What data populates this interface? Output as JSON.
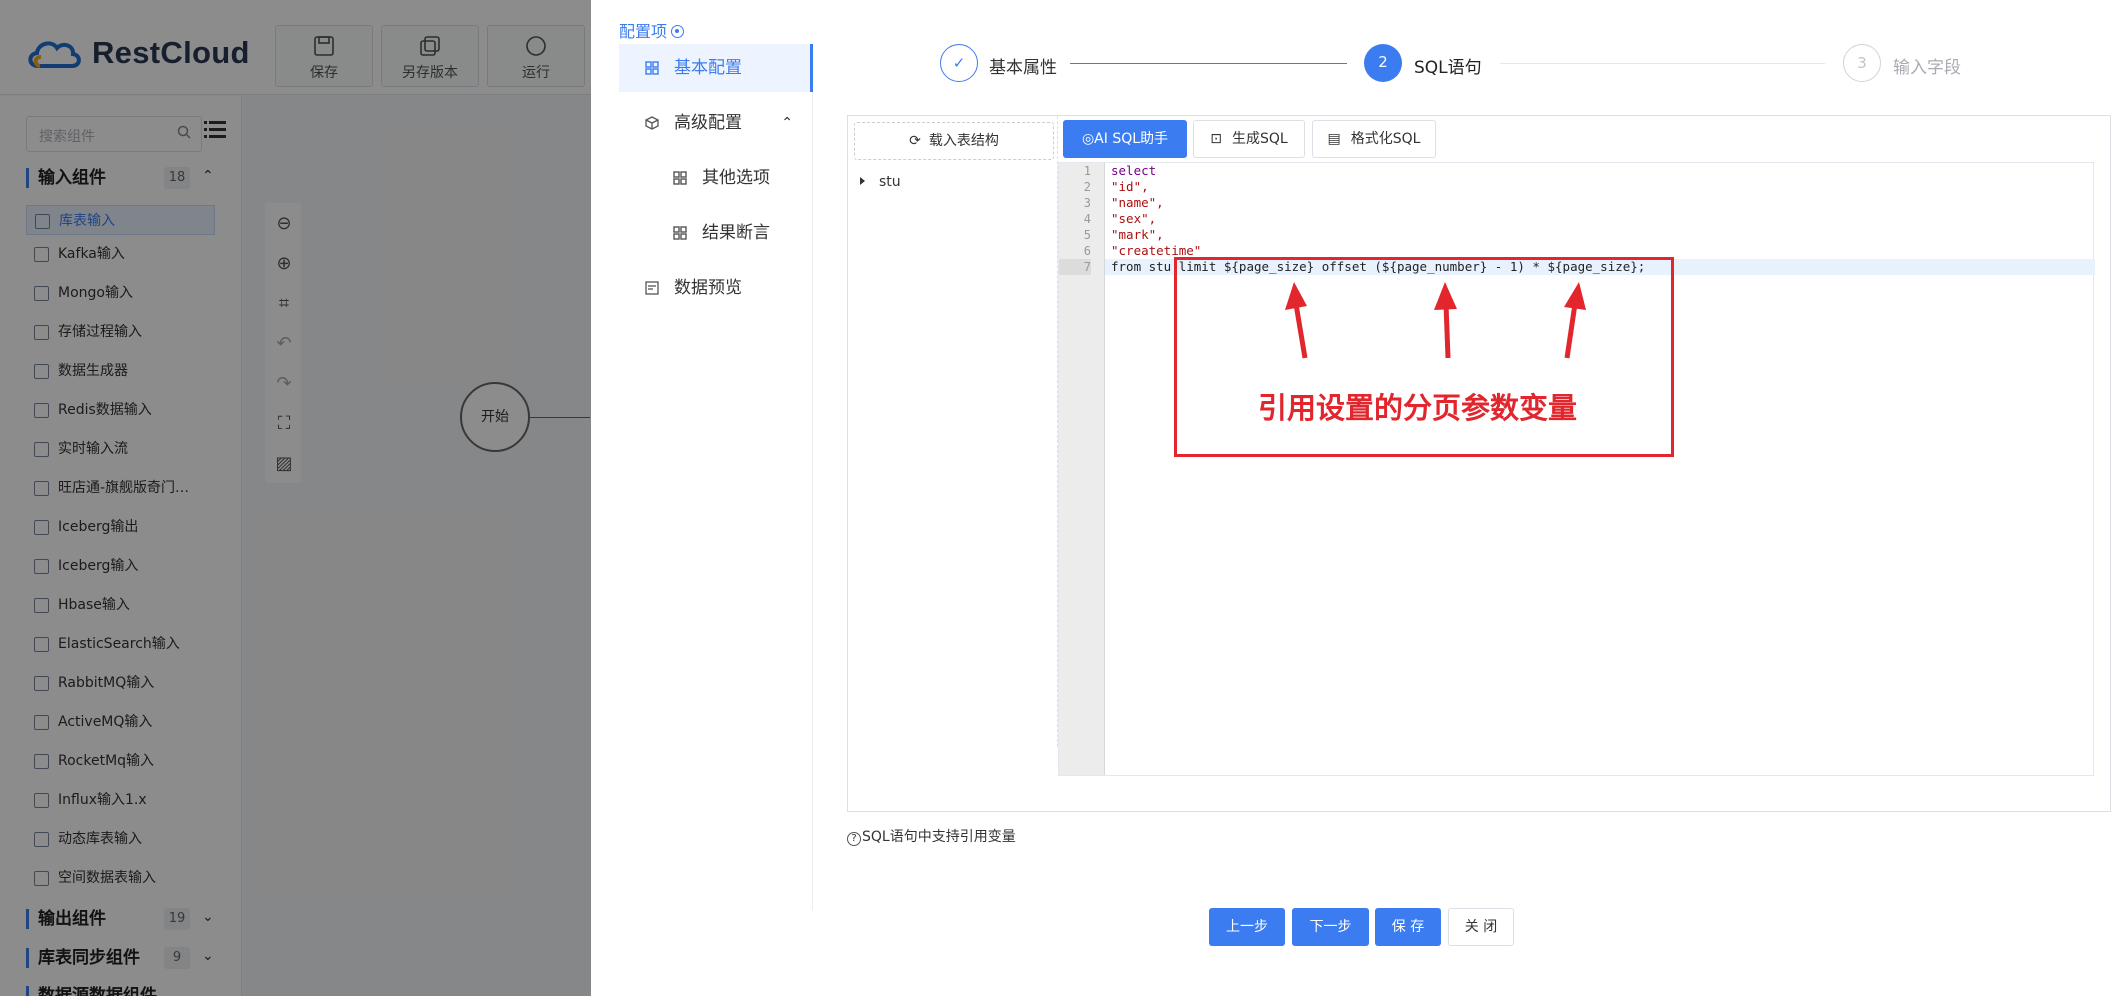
{
  "app": {
    "logo_text": "RestCloud",
    "toolbar": {
      "save": "保存",
      "save_as": "另存版本",
      "run": "运行"
    }
  },
  "left_panel": {
    "search_placeholder": "搜索组件",
    "groups": [
      {
        "title": "输入组件",
        "count": "18"
      },
      {
        "title": "输出组件",
        "count": "19"
      },
      {
        "title": "库表同步组件",
        "count": "9"
      },
      {
        "title": "数据源数据组件"
      }
    ],
    "items": [
      "库表输入",
      "Kafka输入",
      "Mongo输入",
      "存储过程输入",
      "数据生成器",
      "Redis数据输入",
      "实时输入流",
      "旺店通-旗舰版奇门…",
      "Iceberg输出",
      "Iceberg输入",
      "Hbase输入",
      "ElasticSearch输入",
      "RabbitMQ输入",
      "ActiveMQ输入",
      "RocketMq输入",
      "Influx输入1.x",
      "动态库表输入",
      "空间数据表输入"
    ]
  },
  "canvas": {
    "start_node": "开始"
  },
  "drawer": {
    "config_title": "配置项",
    "menu": [
      {
        "label": "基本配置"
      },
      {
        "label": "高级配置"
      },
      {
        "label": "其他选项"
      },
      {
        "label": "结果断言"
      },
      {
        "label": "数据预览"
      }
    ],
    "steps": [
      {
        "num": "✓",
        "label": "基本属性",
        "state": "done"
      },
      {
        "num": "2",
        "label": "SQL语句",
        "state": "active"
      },
      {
        "num": "3",
        "label": "输入字段",
        "state": "pending"
      }
    ],
    "load_structure_btn": "载入表结构",
    "tree_node": "stu",
    "tools": {
      "ai_sql": "AI SQL助手",
      "gen_sql": "生成SQL",
      "format_sql": "格式化SQL"
    },
    "code_lines": [
      "select",
      "\"id\",",
      "\"name\",",
      "\"sex\",",
      "\"mark\",",
      "\"createtime\"",
      "from stu limit ${page_size} offset (${page_number} - 1) * ${page_size};"
    ],
    "line_numbers": [
      "1",
      "2",
      "3",
      "4",
      "5",
      "6",
      "7"
    ],
    "hint": "SQL语句中支持引用变量",
    "buttons": {
      "prev": "上一步",
      "next": "下一步",
      "save": "保 存",
      "close": "关 闭"
    }
  },
  "annotation": {
    "text": "引用设置的分页参数变量"
  },
  "colors": {
    "primary": "#3b7cf0",
    "annotation_red": "#e2262e"
  }
}
